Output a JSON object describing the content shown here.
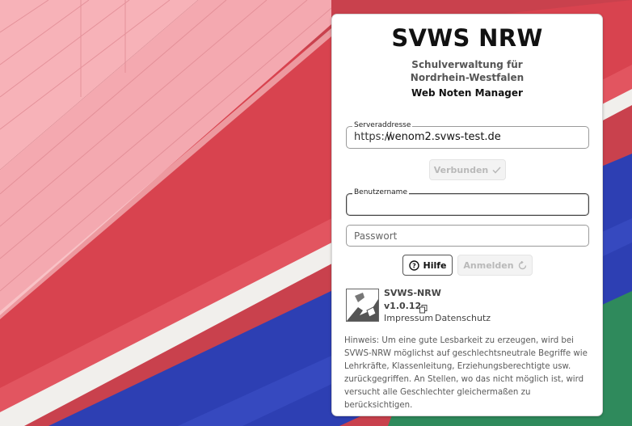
{
  "app": {
    "title": "SVWS NRW",
    "subtitle_line1": "Schulverwaltung für",
    "subtitle_line2": "Nordrhein-Westfalen",
    "product": "Web Noten Manager"
  },
  "server": {
    "label": "Serveraddresse",
    "prefix": "https://",
    "value": "wenom2.svws-test.de"
  },
  "connect_button": {
    "label": "Verbunden",
    "icon": "check-icon",
    "state": "disabled"
  },
  "username": {
    "label": "Benutzername",
    "value": ""
  },
  "password": {
    "placeholder": "Passwort",
    "value": ""
  },
  "help_button": {
    "label": "Hilfe",
    "icon": "question-circle-icon"
  },
  "login_button": {
    "label": "Anmelden",
    "icon": "loading-icon",
    "state": "disabled"
  },
  "about": {
    "name": "SVWS-NRW",
    "version": "v1.0.12",
    "copy_icon": "copy-icon",
    "logo_icon": "nrw-logo-icon",
    "impressum": "Impressum",
    "datenschutz": "Datenschutz"
  },
  "hint": "Hinweis: Um eine gute Lesbarkeit zu erzeugen, wird bei SVWS-NRW möglichst auf geschlechtsneutrale Begriffe wie Lehrkräfte, Klassenleitung, Erziehungsberechtigte usw. zurückgegriffen. An Stellen, wo das nicht möglich ist, wird versucht alle Geschlechter gleichermaßen zu berücksichtigen.",
  "colors": {
    "accent": "#111111",
    "disabled_text": "#b9b9b9",
    "background_red": "#d2414f",
    "background_pink": "#f2a7ad",
    "background_blue": "#2a3fb4",
    "background_green": "#2e8a5a"
  }
}
